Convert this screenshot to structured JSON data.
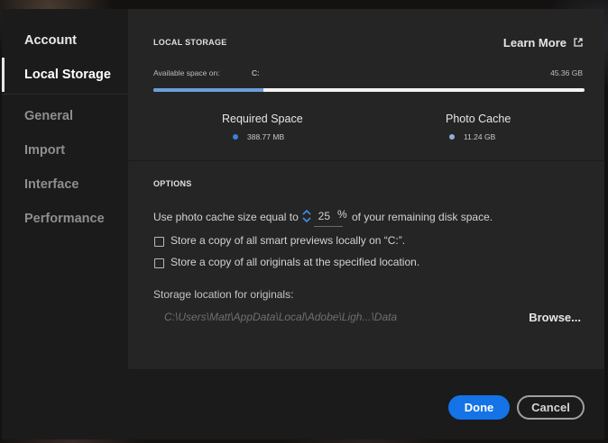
{
  "sidebar": {
    "items": [
      {
        "label": "Account",
        "state": "enabled"
      },
      {
        "label": "Local Storage",
        "state": "active"
      },
      {
        "label": "General",
        "state": "dim"
      },
      {
        "label": "Import",
        "state": "dim"
      },
      {
        "label": "Interface",
        "state": "dim"
      },
      {
        "label": "Performance",
        "state": "dim"
      }
    ]
  },
  "local_storage": {
    "title": "LOCAL STORAGE",
    "learn_more": "Learn More",
    "available_label": "Available space on:",
    "drive": "C:",
    "available_size": "45.36 GB",
    "used_fraction": 0.255,
    "required": {
      "label": "Required Space",
      "value": "388.77 MB",
      "color": "#3b82e0"
    },
    "cache": {
      "label": "Photo Cache",
      "value": "11.24 GB",
      "color": "#8fb0d8"
    }
  },
  "options": {
    "title": "OPTIONS",
    "cache_prefix": "Use photo cache size equal to",
    "cache_percent": "25",
    "percent_sign": "%",
    "cache_suffix": "of your remaining disk space.",
    "checkbox_previews": {
      "label": "Store a copy of all smart previews locally on “C:”.",
      "checked": false
    },
    "checkbox_originals": {
      "label": "Store a copy of all originals at the specified location.",
      "checked": false
    },
    "storage_location_label": "Storage location for originals:",
    "storage_path": "C:\\Users\\Matt\\AppData\\Local\\Adobe\\Ligh...\\Data",
    "browse_label": "Browse..."
  },
  "footer": {
    "done_label": "Done",
    "cancel_label": "Cancel"
  },
  "colors": {
    "accent": "#1473e6",
    "bar_fill": "#6d9ed8"
  }
}
